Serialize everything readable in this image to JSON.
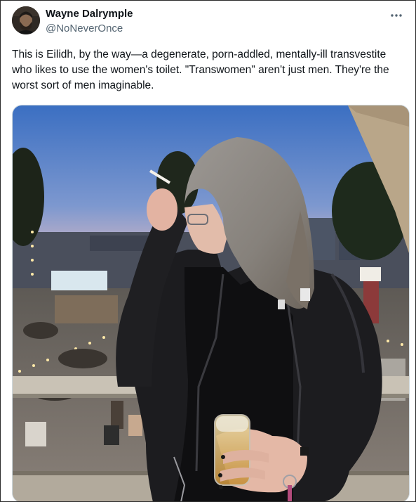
{
  "tweet": {
    "author": {
      "display_name": "Wayne Dalrymple",
      "handle": "@NoNeverOnce"
    },
    "text": "This is Eilidh, by the way—a degenerate, porn-addled, mentally-ill transvestite who likes to use the women's toilet. \"Transwomen\" aren't just men. They're the worst sort of men imaginable.",
    "more_icon": "ellipsis-icon"
  },
  "media": {
    "type": "photo",
    "colors": {
      "sky_top": "#3f73c4",
      "sky_bottom": "#c9b2c9",
      "jacket": "#1c1c1f",
      "hair": "#8e8a86"
    }
  }
}
